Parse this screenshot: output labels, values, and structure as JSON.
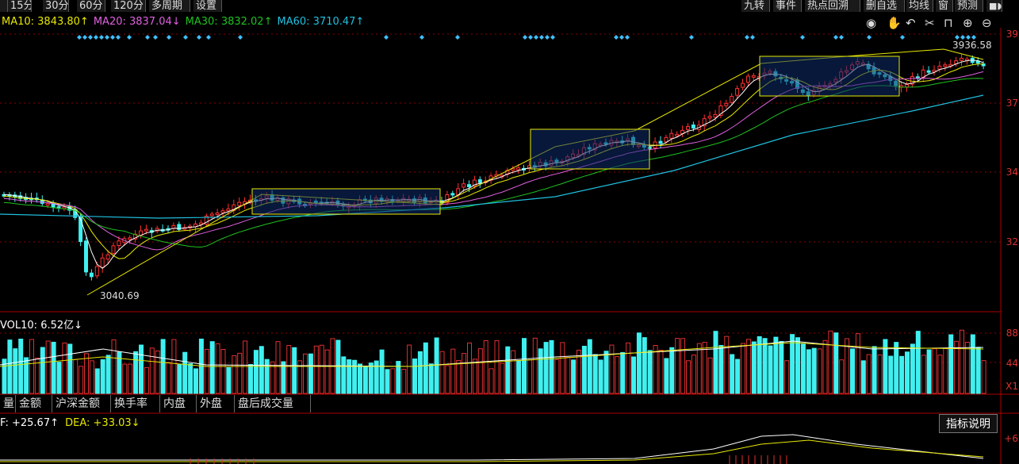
{
  "toolbar": {
    "left_items": [
      "15分",
      "30分",
      "60分",
      "120分",
      "多周期",
      "设置"
    ],
    "right_items": [
      "九转",
      "事件",
      "热点回溯",
      "删自选",
      "均线",
      "窗",
      "预测"
    ]
  },
  "ma_legend": {
    "ma10": "MA10: 3843.80↑",
    "ma20": "MA20: 3837.04↓",
    "ma30": "MA30: 3832.02↑",
    "ma60": "MA60: 3710.47↑",
    "colors": {
      "ma10": "#e8e800",
      "ma20": "#e060e0",
      "ma30": "#20c020",
      "ma60": "#20c0e0"
    }
  },
  "tools": [
    "eye-icon",
    "hand-icon",
    "undo-icon",
    "scissors-icon",
    "lock-icon",
    "zoom-in-icon",
    "zoom-out-icon"
  ],
  "price_axis": [
    "39",
    "37",
    "34",
    "32"
  ],
  "price_annotations": {
    "high": "3936.58",
    "low": "3040.69"
  },
  "volume": {
    "label": "VOL10: 6.52亿↓",
    "axis": [
      "88",
      "44",
      "X1"
    ]
  },
  "indicator_tabs": [
    "量",
    "金额",
    "沪深金额",
    "换手率",
    "内盘",
    "外盘",
    "盘后成交量"
  ],
  "macd": {
    "dif": "F: +25.67↑",
    "dea": "DEA: +33.03↓",
    "axis": "+6"
  },
  "help_button": "指标说明",
  "chart_data": {
    "type": "candlestick",
    "ma10": 3843.8,
    "ma20": 3837.04,
    "ma30": 3832.02,
    "ma60": 3710.47,
    "price_high": 3936.58,
    "price_low": 3040.69,
    "volume_ma10_yi": 6.52,
    "macd_dif": 25.67,
    "macd_dea": 33.03
  }
}
